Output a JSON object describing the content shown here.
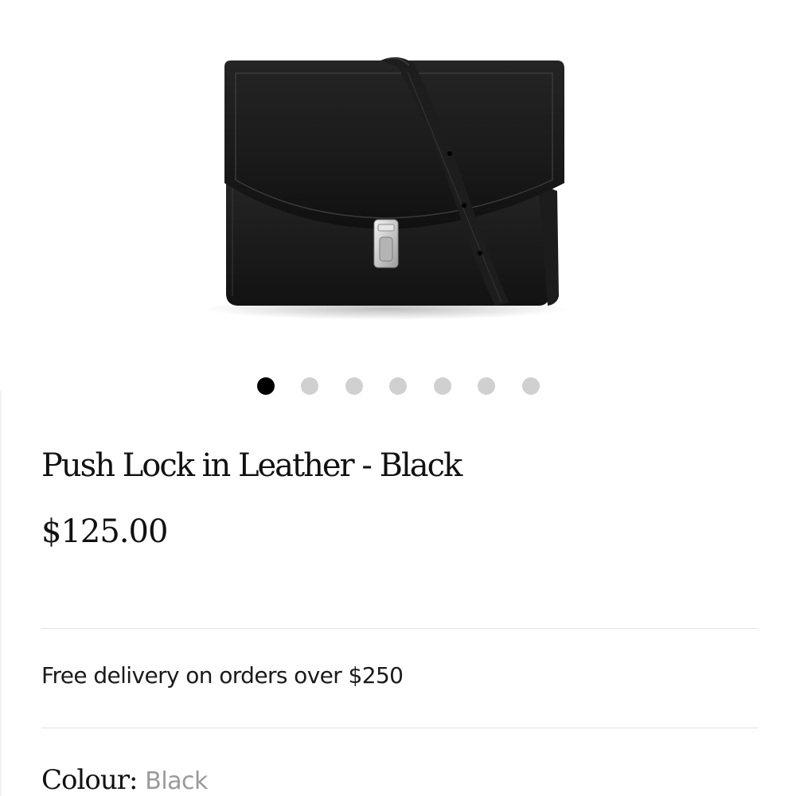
{
  "product": {
    "title": "Push Lock in Leather - Black",
    "price": "$125.00",
    "image": "product-photo-black-leather-satchel"
  },
  "carousel": {
    "dot_count": 7,
    "active_index": 0
  },
  "delivery": {
    "text": "Free delivery on orders over $250"
  },
  "colour": {
    "label": "Colour:",
    "value": "Black"
  },
  "colors": {
    "text": "#111111",
    "muted": "#9a9a9a",
    "dot_active": "#000000",
    "dot_inactive": "#d0d0d0",
    "divider": "#e3e3e3"
  }
}
